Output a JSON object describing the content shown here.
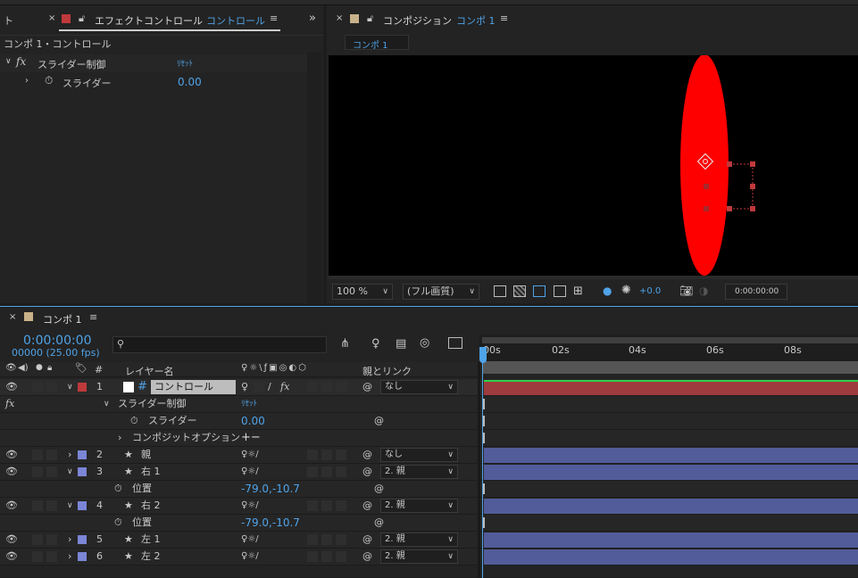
{
  "top_strip": {},
  "effect_panel": {
    "tab_left_fragment": "ト",
    "tab_title": "エフェクトコントロール",
    "tab_target": "コントロール",
    "subheader": "コンポ 1・コントロール",
    "effect_name": "スライダー制御",
    "reset_label": "ﾘｾｯﾄ",
    "param_name": "スライダー",
    "param_value": "0.00"
  },
  "comp_panel": {
    "tab_title": "コンポジション",
    "tab_target": "コンポ 1",
    "comp_tab": "コンポ 1",
    "zoom": "100 %",
    "resolution": "(フル画質)",
    "exposure": "+0.0",
    "timecode": "0:00:00:00"
  },
  "timeline": {
    "tab_title": "コンポ 1",
    "timecode": "0:00:00:00",
    "frame_info": "00000 (25.00 fps)",
    "col_num": "#",
    "col_layer_name": "レイヤー名",
    "col_parent": "親とリンク",
    "ruler": [
      "00s",
      "02s",
      "04s",
      "06s",
      "08s"
    ],
    "rows": [
      {
        "num": "1",
        "name": "コントロール",
        "parent": "なし"
      },
      {
        "effect_name": "スライダー制御",
        "reset": "ﾘｾｯﾄ"
      },
      {
        "param": "スライダー",
        "value": "0.00"
      },
      {
        "param": "コンポジットオプション",
        "value": "+−"
      },
      {
        "num": "2",
        "name": "親",
        "parent": "なし"
      },
      {
        "num": "3",
        "name": "右 1",
        "parent": "2. 親"
      },
      {
        "param": "位置",
        "value": "-79.0,-10.7"
      },
      {
        "num": "4",
        "name": "右 2",
        "parent": "2. 親"
      },
      {
        "param": "位置",
        "value": "-79.0,-10.7"
      },
      {
        "num": "5",
        "name": "左 1",
        "parent": "2. 親"
      },
      {
        "num": "6",
        "name": "左 2",
        "parent": "2. 親"
      }
    ]
  },
  "colors": {
    "accent": "#4fa3e8",
    "red_label": "#c0393b",
    "blue_label": "#7b86d6",
    "red_bar": "#9e3b3e",
    "blue_bar": "#525c9a",
    "ellipse": "#ff0000"
  }
}
